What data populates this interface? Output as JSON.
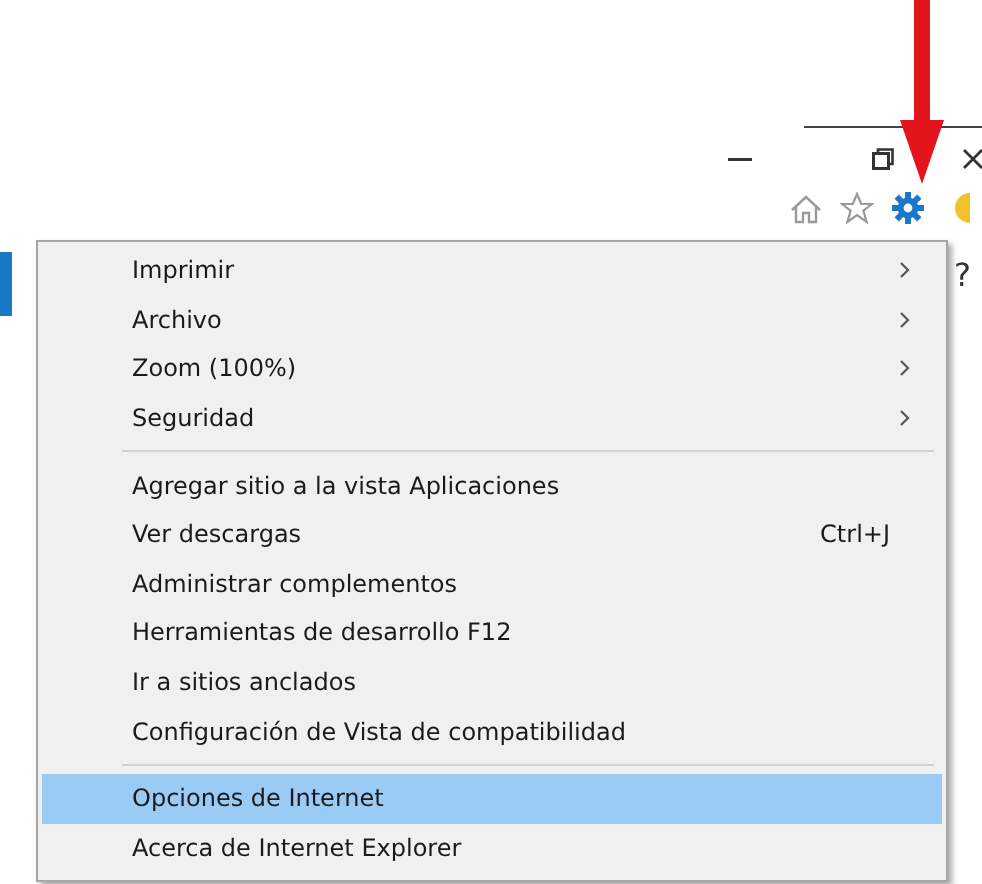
{
  "toolbar": {
    "help_glyph": "?"
  },
  "menu": {
    "groups": [
      [
        {
          "label": "Imprimir",
          "submenu": true,
          "selected": false
        },
        {
          "label": "Archivo",
          "submenu": true,
          "selected": false
        },
        {
          "label": "Zoom (100%)",
          "submenu": true,
          "selected": false
        },
        {
          "label": "Seguridad",
          "submenu": true,
          "selected": false
        }
      ],
      [
        {
          "label": "Agregar sitio a la vista Aplicaciones",
          "submenu": false,
          "selected": false
        },
        {
          "label": "Ver descargas",
          "shortcut": "Ctrl+J",
          "submenu": false,
          "selected": false
        },
        {
          "label": "Administrar complementos",
          "submenu": false,
          "selected": false
        },
        {
          "label": "Herramientas de desarrollo F12",
          "submenu": false,
          "selected": false
        },
        {
          "label": "Ir a sitios anclados",
          "submenu": false,
          "selected": false
        },
        {
          "label": "Configuración de Vista de compatibilidad",
          "submenu": false,
          "selected": false
        }
      ],
      [
        {
          "label": "Opciones de Internet",
          "submenu": false,
          "selected": true
        },
        {
          "label": "Acerca de Internet Explorer",
          "submenu": false,
          "selected": false
        }
      ]
    ]
  }
}
